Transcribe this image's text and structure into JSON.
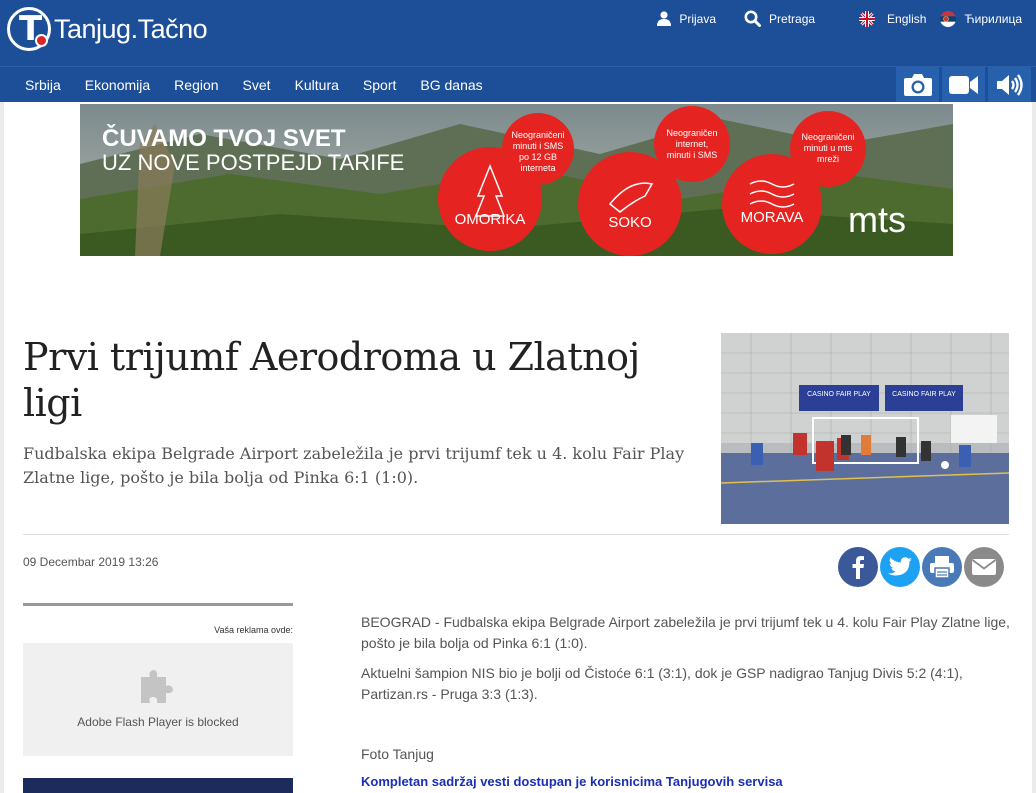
{
  "header": {
    "logo_text": "Tanjug.Tačno",
    "login_label": "Prijava",
    "search_label": "Pretraga",
    "english_label": "English",
    "cyrillic_label": "Ћирилица"
  },
  "nav": {
    "items": [
      "Srbija",
      "Ekonomija",
      "Region",
      "Svet",
      "Kultura",
      "Sport",
      "BG danas"
    ],
    "icons": [
      "camera-icon",
      "video-icon",
      "audio-icon"
    ]
  },
  "banner": {
    "headline_line1": "ČUVAMO TVOJ SVET",
    "headline_line2": "UZ NOVE POSTPEJD TARIFE",
    "offers": [
      {
        "name": "OMORIKA",
        "text": [
          "Neograničeni",
          "minuti i SMS",
          "po 12 GB",
          "interneta"
        ]
      },
      {
        "name": "SOKO",
        "text": [
          "Neograničen",
          "internet,",
          "minuti i SMS"
        ]
      },
      {
        "name": "MORAVA",
        "text": [
          "Neograničeni",
          "minuti u mts",
          "mreži"
        ]
      }
    ],
    "brand": "mts"
  },
  "article": {
    "title": "Prvi trijumf Aerodroma u Zlatnoj ligi",
    "lead": "Fudbalska ekipa Belgrade Airport zabeležila je prvi trijumf tek u 4. kolu Fair Play Zlatne lige, pošto je bila bolja od Pinka 6:1 (1:0).",
    "date": "09 Decembar 2019 13:26",
    "paragraphs": [
      "BEOGRAD - Fudbalska ekipa Belgrade Airport zabeležila je prvi trijumf tek u 4. kolu Fair Play Zlatne lige, pošto je bila bolja od Pinka 6:1 (1:0).",
      "Aktuelni šampion NIS bio je bolji od Čistoće 6:1 (3:1), dok je GSP nadigrao Tanjug Divis 5:2 (4:1), Partizan.rs - Pruga 3:3 (1:3)."
    ],
    "photo_credit": "Foto Tanjug",
    "full_content_link": "Kompletan sadržaj vesti dostupan je korisnicima Tanjugovih servisa",
    "photo_banner_1": "CASINO FAIR PLAY",
    "photo_banner_2": "CASINO FAIR PLAY"
  },
  "share": [
    "facebook-icon",
    "twitter-icon",
    "print-icon",
    "email-icon"
  ],
  "sidebar": {
    "ad_label": "Vaša reklama ovde:",
    "flash_message": "Adobe Flash Player is blocked"
  },
  "colors": {
    "header_bg": "#1c4f97",
    "nav_icon_bg": "#2760ad",
    "facebook": "#3b5998",
    "twitter": "#1da1f2",
    "print": "#4a79b8",
    "email": "#8a8a8a",
    "link": "#1a2fb5"
  }
}
